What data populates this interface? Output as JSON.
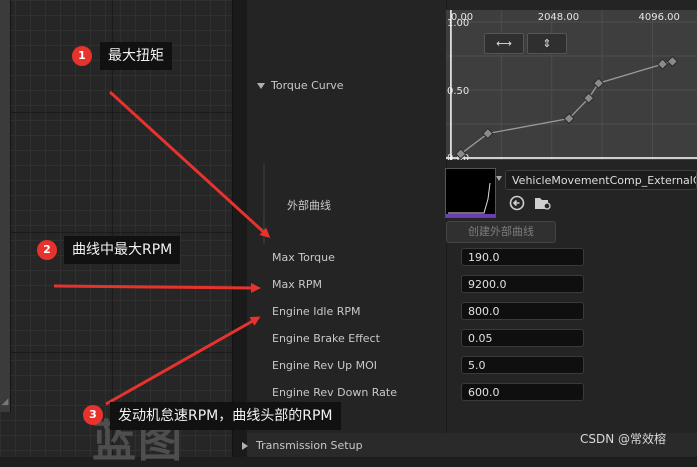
{
  "graph": {
    "watermark": "蓝图"
  },
  "torque_curve": {
    "label": "Torque Curve",
    "chart_data": {
      "type": "line",
      "x_ticks": [
        "0.00",
        "2048.00",
        "4096.00"
      ],
      "y_ticks": [
        "1.00",
        "0.50",
        "0.00"
      ],
      "x": [
        200,
        750,
        2400,
        2800,
        3000,
        4300,
        4500
      ],
      "y": [
        0.03,
        0.18,
        0.29,
        0.44,
        0.55,
        0.69,
        0.71
      ],
      "xlim": [
        -100,
        5000
      ],
      "ylim": [
        0,
        1.0
      ],
      "colors": {
        "background": "#3e3e3e",
        "grid": "#4d4d4d",
        "line": "#9a9a9a",
        "axis": "#ffffff",
        "key": "#8a8a8a"
      }
    },
    "fit_horizontal_icon": "fit-horizontal-icon",
    "fit_vertical_icon": "fit-vertical-icon",
    "fit_horizontal_glyph": "⟷",
    "fit_vertical_glyph": "⇕"
  },
  "external_curve": {
    "label": "外部曲线",
    "asset": "VehicleMovementComp_ExternalCurve",
    "create_button": "创建外部曲线"
  },
  "properties": [
    {
      "label": "Max Torque",
      "value": "190.0"
    },
    {
      "label": "Max RPM",
      "value": "9200.0"
    },
    {
      "label": "Engine Idle RPM",
      "value": "800.0"
    },
    {
      "label": "Engine Brake Effect",
      "value": "0.05"
    },
    {
      "label": "Engine Rev Up MOI",
      "value": "5.0"
    },
    {
      "label": "Engine Rev Down Rate",
      "value": "600.0"
    }
  ],
  "transmission": {
    "label": "Transmission Setup"
  },
  "callouts": [
    {
      "num": "1",
      "text": "最大扭矩"
    },
    {
      "num": "2",
      "text": "曲线中最大RPM"
    },
    {
      "num": "3",
      "text": "发动机怠速RPM，曲线头部的RPM"
    }
  ],
  "credit": "CSDN @常效榕",
  "colors": {
    "arrow": "#e8322e",
    "badge": "#e8322e"
  }
}
